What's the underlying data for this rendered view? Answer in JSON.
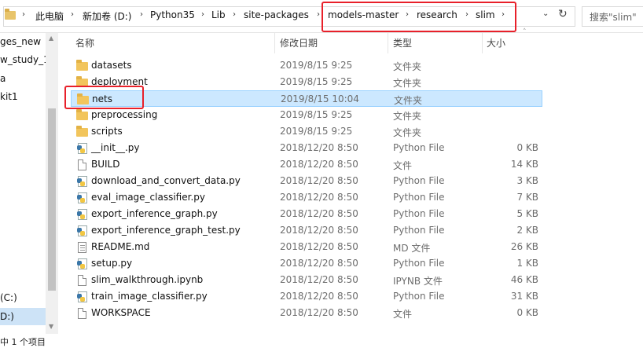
{
  "address_bar": {
    "crumbs": [
      "此电脑",
      "新加卷 (D:)",
      "Python35",
      "Lib",
      "site-packages",
      "models-master",
      "research",
      "slim"
    ],
    "search_placeholder": "搜索\"slim\"",
    "refresh_icon": "refresh-icon",
    "dropdown_icon": "chevron-down-icon"
  },
  "nav": {
    "items": [
      "ges_new",
      "w_study_1",
      "a",
      "kit1",
      "(C:)",
      "D:)"
    ]
  },
  "columns": {
    "name": "名称",
    "date": "修改日期",
    "type": "类型",
    "size": "大小"
  },
  "files": [
    {
      "name": "datasets",
      "date": "2019/8/15 9:25",
      "type": "文件夹",
      "size": "",
      "icon": "folder-icon"
    },
    {
      "name": "deployment",
      "date": "2019/8/15 9:25",
      "type": "文件夹",
      "size": "",
      "icon": "folder-icon"
    },
    {
      "name": "nets",
      "date": "2019/8/15 10:04",
      "type": "文件夹",
      "size": "",
      "icon": "folder-icon",
      "selected": true
    },
    {
      "name": "preprocessing",
      "date": "2019/8/15 9:25",
      "type": "文件夹",
      "size": "",
      "icon": "folder-icon"
    },
    {
      "name": "scripts",
      "date": "2019/8/15 9:25",
      "type": "文件夹",
      "size": "",
      "icon": "folder-icon"
    },
    {
      "name": "__init__.py",
      "date": "2018/12/20 8:50",
      "type": "Python File",
      "size": "0 KB",
      "icon": "python-file-icon"
    },
    {
      "name": "BUILD",
      "date": "2018/12/20 8:50",
      "type": "文件",
      "size": "14 KB",
      "icon": "file-icon"
    },
    {
      "name": "download_and_convert_data.py",
      "date": "2018/12/20 8:50",
      "type": "Python File",
      "size": "3 KB",
      "icon": "python-file-icon"
    },
    {
      "name": "eval_image_classifier.py",
      "date": "2018/12/20 8:50",
      "type": "Python File",
      "size": "7 KB",
      "icon": "python-file-icon"
    },
    {
      "name": "export_inference_graph.py",
      "date": "2018/12/20 8:50",
      "type": "Python File",
      "size": "5 KB",
      "icon": "python-file-icon"
    },
    {
      "name": "export_inference_graph_test.py",
      "date": "2018/12/20 8:50",
      "type": "Python File",
      "size": "2 KB",
      "icon": "python-file-icon"
    },
    {
      "name": "README.md",
      "date": "2018/12/20 8:50",
      "type": "MD 文件",
      "size": "26 KB",
      "icon": "text-file-icon"
    },
    {
      "name": "setup.py",
      "date": "2018/12/20 8:50",
      "type": "Python File",
      "size": "1 KB",
      "icon": "python-file-icon"
    },
    {
      "name": "slim_walkthrough.ipynb",
      "date": "2018/12/20 8:50",
      "type": "IPYNB 文件",
      "size": "46 KB",
      "icon": "file-icon"
    },
    {
      "name": "train_image_classifier.py",
      "date": "2018/12/20 8:50",
      "type": "Python File",
      "size": "31 KB",
      "icon": "python-file-icon"
    },
    {
      "name": "WORKSPACE",
      "date": "2018/12/20 8:50",
      "type": "文件",
      "size": "0 KB",
      "icon": "file-icon"
    }
  ],
  "status": {
    "text": "中 1 个项目"
  },
  "colors": {
    "highlight_box": "#e8202a",
    "selection": "#cce8ff",
    "folder": "#f2c55c"
  }
}
